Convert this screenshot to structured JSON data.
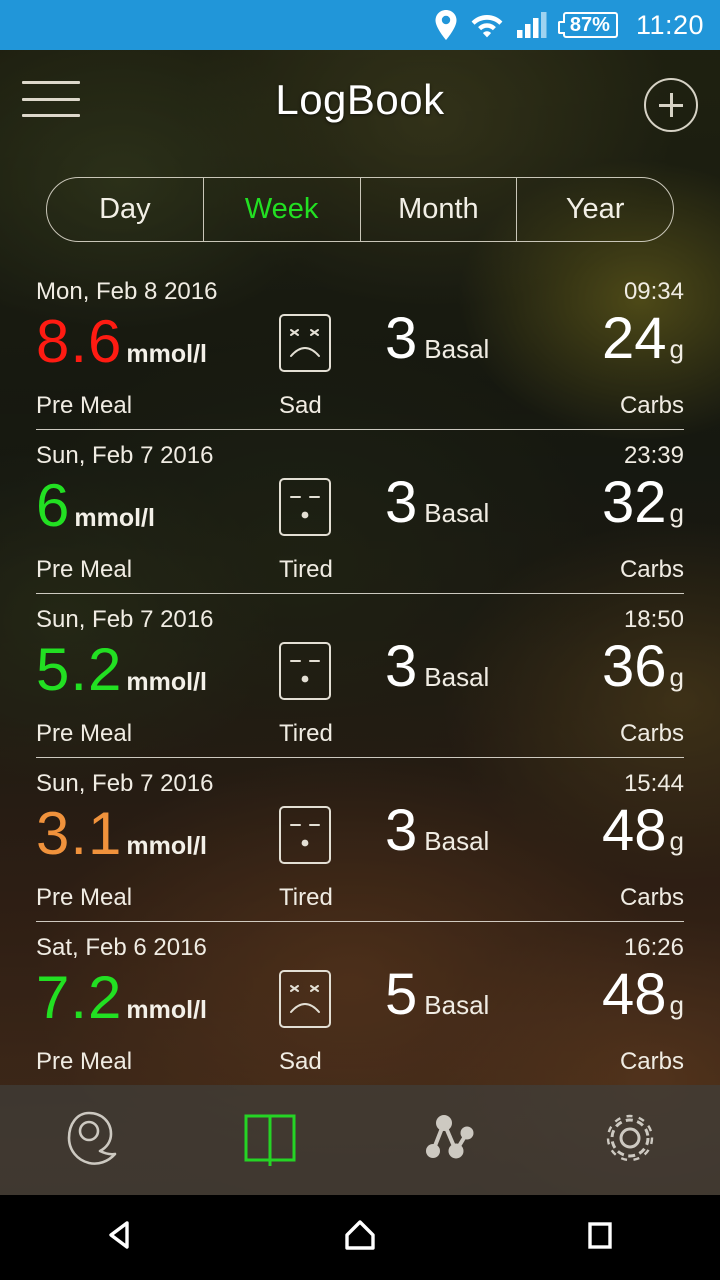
{
  "status_bar": {
    "time": "11:20",
    "battery_percent": "87%",
    "icons": [
      "location-pin-icon",
      "wifi-icon",
      "signal-bars-icon",
      "battery-icon"
    ],
    "bg_color": "#2196d9"
  },
  "app_bar": {
    "title": "LogBook",
    "menu_icon": "hamburger-menu-icon",
    "add_icon": "plus-circle-icon"
  },
  "segmented_control": {
    "options": [
      {
        "label": "Day",
        "active": false
      },
      {
        "label": "Week",
        "active": true
      },
      {
        "label": "Month",
        "active": false
      },
      {
        "label": "Year",
        "active": false
      }
    ],
    "active_color": "#22e022"
  },
  "colors": {
    "high": "#ff1b12",
    "normal": "#22e022",
    "low": "#f0923c",
    "text": "#f0ece3"
  },
  "units": {
    "glucose": "mmol/l",
    "carbs": "g",
    "basal_label": "Basal",
    "carbs_label": "Carbs",
    "meal_label": "Pre Meal"
  },
  "entries": [
    {
      "date": "Mon, Feb 8 2016",
      "time": "09:34",
      "glucose": "8.6",
      "glucose_unit": "mmol/l",
      "glucose_color": "#ff1b12",
      "meal": "Pre Meal",
      "mood": "Sad",
      "mood_icon": "sad-face-icon",
      "basal": "3",
      "basal_label": "Basal",
      "carbs": "24",
      "carbs_unit": "g",
      "carbs_label": "Carbs"
    },
    {
      "date": "Sun, Feb 7 2016",
      "time": "23:39",
      "glucose": "6",
      "glucose_unit": "mmol/l",
      "glucose_color": "#22e022",
      "meal": "Pre Meal",
      "mood": "Tired",
      "mood_icon": "tired-face-icon",
      "basal": "3",
      "basal_label": "Basal",
      "carbs": "32",
      "carbs_unit": "g",
      "carbs_label": "Carbs"
    },
    {
      "date": "Sun, Feb 7 2016",
      "time": "18:50",
      "glucose": "5.2",
      "glucose_unit": "mmol/l",
      "glucose_color": "#22e022",
      "meal": "Pre Meal",
      "mood": "Tired",
      "mood_icon": "tired-face-icon",
      "basal": "3",
      "basal_label": "Basal",
      "carbs": "36",
      "carbs_unit": "g",
      "carbs_label": "Carbs"
    },
    {
      "date": "Sun, Feb 7 2016",
      "time": "15:44",
      "glucose": "3.1",
      "glucose_unit": "mmol/l",
      "glucose_color": "#f0923c",
      "meal": "Pre Meal",
      "mood": "Tired",
      "mood_icon": "tired-face-icon",
      "basal": "3",
      "basal_label": "Basal",
      "carbs": "48",
      "carbs_unit": "g",
      "carbs_label": "Carbs"
    },
    {
      "date": "Sat, Feb 6 2016",
      "time": "16:26",
      "glucose": "7.2",
      "glucose_unit": "mmol/l",
      "glucose_color": "#22e022",
      "meal": "Pre Meal",
      "mood": "Sad",
      "mood_icon": "sad-face-icon",
      "basal": "5",
      "basal_label": "Basal",
      "carbs": "48",
      "carbs_unit": "g",
      "carbs_label": "Carbs"
    }
  ],
  "bottom_nav": [
    {
      "name": "blood-drop-icon",
      "active": false
    },
    {
      "name": "logbook-icon",
      "active": true
    },
    {
      "name": "chart-icon",
      "active": false
    },
    {
      "name": "settings-gear-icon",
      "active": false
    }
  ],
  "android_nav": [
    {
      "name": "back-icon"
    },
    {
      "name": "home-icon"
    },
    {
      "name": "recents-icon"
    }
  ]
}
